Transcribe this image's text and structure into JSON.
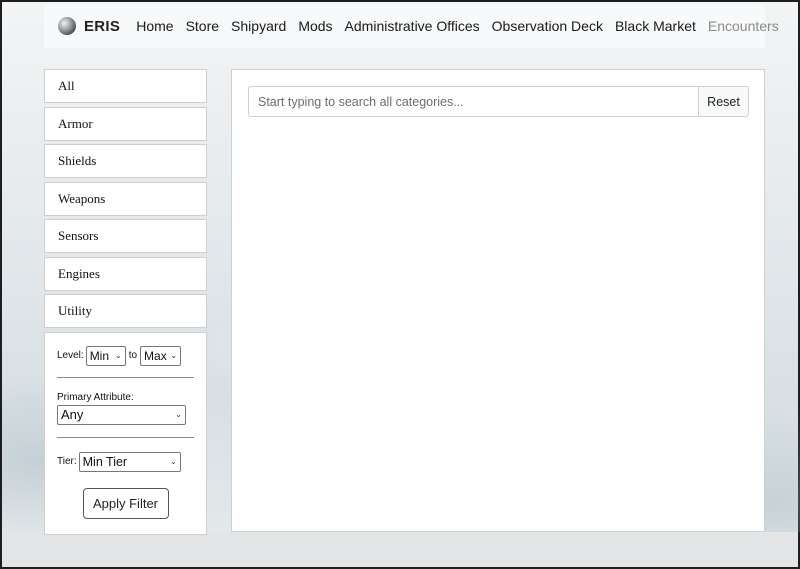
{
  "navbar": {
    "brand": "ERIS",
    "links": [
      "Home",
      "Store",
      "Shipyard",
      "Mods",
      "Administrative Offices",
      "Observation Deck",
      "Black Market",
      "Encounters"
    ]
  },
  "sidebar": {
    "categories": [
      "All",
      "Armor",
      "Shields",
      "Weapons",
      "Sensors",
      "Engines",
      "Utility"
    ]
  },
  "filters": {
    "level_label": "Level:",
    "level_min": "Min",
    "level_to": "to",
    "level_max": "Max",
    "primary_attribute_label": "Primary Attribute:",
    "primary_attribute_value": "Any",
    "tier_label": "Tier:",
    "tier_value": "Min Tier",
    "apply_label": "Apply Filter"
  },
  "search": {
    "placeholder": "Start typing to search all categories...",
    "value": "",
    "reset_label": "Reset"
  },
  "icons": {
    "brand": "planet-logo-icon",
    "dropdown": "chevron-down-icon"
  }
}
